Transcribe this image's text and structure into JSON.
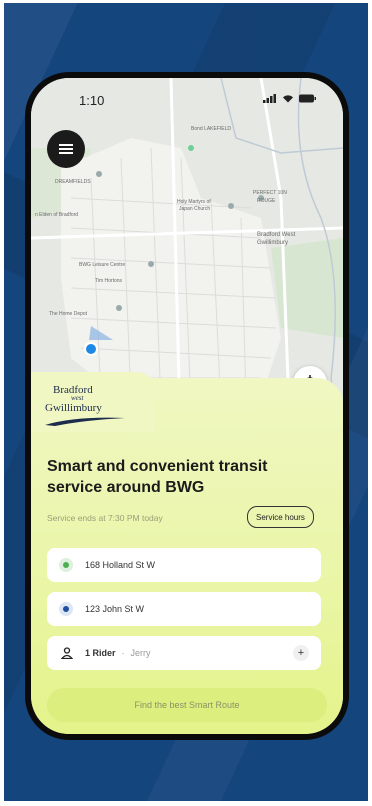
{
  "status": {
    "time": "1:10"
  },
  "map": {
    "labels": {
      "bond_lake": "Bond LAKEFIELD",
      "perfect_10": "PERFECT 10N",
      "perfect_10b": "ROUGE",
      "holy_martyrs": "Holy Martyrs of",
      "japan_church": "Japan Church",
      "bradford_west": "Bradford West",
      "gwillimbury": "Gwillimbury",
      "elden": "n Elden of Bradford",
      "leisure": "BWG Leisure Centre",
      "the_home": "The Home Depot",
      "dreamfields": "DREAMFIELDS",
      "tim": "Tim Hortons"
    }
  },
  "logo": {
    "line1": "Bradford",
    "line2": "west",
    "line3": "Gwillimbury"
  },
  "headline": "Smart and convenient transit service around BWG",
  "service_ends": "Service ends at 7:30 PM today",
  "service_hours_label": "Service hours",
  "pickup": "168 Holland St W",
  "dropoff": "123 John St W",
  "riders": {
    "count_label": "1 Rider",
    "separator": "·",
    "name": "Jerry"
  },
  "plus": "+",
  "cta": "Find the best Smart Route",
  "colors": {
    "background": "#15457d",
    "panel": "#eaf6a8",
    "pickup_dot": "#4caf50",
    "dropoff_dot": "#1f4f9c",
    "location_dot": "#1e88e5"
  }
}
